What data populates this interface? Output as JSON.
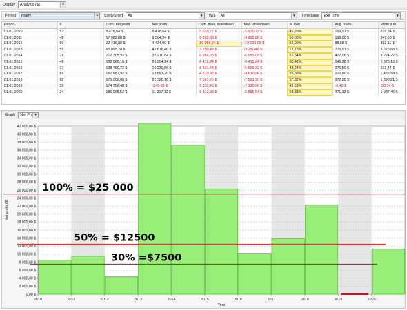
{
  "toolbar": {
    "display_label": "Display",
    "display_value": "Analysis ($)"
  },
  "filters": {
    "period_label": "Period",
    "period_value": "Yearly",
    "longshort_label": "Long/Short",
    "longshort_value": "All",
    "wl_label": "W/L",
    "wl_value": "All",
    "timebase_label": "Time base",
    "timebase_value": "Exit Time"
  },
  "table": {
    "headers": [
      "Period",
      "#",
      "Cum. net profit",
      "Net profit",
      "Cum. max. drawdown",
      "Max. drawdown",
      "% Win",
      "Avg. trade",
      "Profit p.m."
    ],
    "rows": [
      [
        "01.01.2010",
        "53",
        "8 478,64 $",
        "8 478,64 $",
        "-5 930,72 $",
        "-5 930,72 $",
        "45,28%",
        "159,97 $",
        "828,84 $"
      ],
      [
        "01.01.2011",
        "48",
        "17 982,88 $",
        "9 504,24 $",
        "-9 992,88 $",
        "-9 992,88 $",
        "50,00%",
        "198,00 $",
        "847,60 $"
      ],
      [
        "01.01.2012",
        "50",
        "22 416,88 $",
        "4 434,00 $",
        "-10 056,24 $",
        "-10 036,08 $",
        "52,00%",
        "88,68 $",
        "383,11 $"
      ],
      [
        "01.01.2013",
        "55",
        "65 095,28 $",
        "42 678,40 $",
        "-3 250,48 $",
        "-3 250,48 $",
        "72,73%",
        "775,97 $",
        "3 625,68 $"
      ],
      [
        "01.01.2014",
        "78",
        "102 305,92 $",
        "37 210,64 $",
        "-6 966,08 $",
        "-6 966,08 $",
        "61,54%",
        "477,06 $",
        "3 224,22 $"
      ],
      [
        "01.01.2015",
        "48",
        "128 560,16 $",
        "26 254,24 $",
        "-6 415,84 $",
        "-6 415,84 $",
        "60,42%",
        "546,96 $",
        "2 376,13 $"
      ],
      [
        "01.01.2016",
        "37",
        "138 790,72 $",
        "10 230,56 $",
        "-8 331,44 $",
        "-5 626,32 $",
        "43,24%",
        "276,50 $",
        "931,44 $"
      ],
      [
        "01.01.2017",
        "65",
        "152 687,92 $",
        "13 897,20 $",
        "-4 610,96 $",
        "-4 610,96 $",
        "55,38%",
        "213,80 $",
        "1 456,58 $"
      ],
      [
        "01.01.2018",
        "82",
        "175 008,08 $",
        "22 320,16 $",
        "-7 581,20 $",
        "-7 581,20 $",
        "57,32%",
        "272,20 $",
        "1 893,21 $"
      ],
      [
        "01.01.2019",
        "39",
        "174 758,40 $",
        "-249,68 $",
        "-7 332,40 $",
        "-7 130,96 $",
        "43,59%",
        "-6,40 $",
        "-30,34 $"
      ],
      [
        "01.01.2020",
        "24",
        "186 065,52 $",
        "11 307,12 $",
        "-6 312,88 $",
        "-5 585,84 $",
        "58,33%",
        "471,13 $",
        "1 937,46 $"
      ]
    ]
  },
  "graph": {
    "graph_label": "Graph",
    "metric_value": "Net Profit"
  },
  "chart_data": {
    "type": "bar",
    "categories": [
      "2010",
      "2011",
      "2012",
      "2013",
      "2014",
      "2015",
      "2016",
      "2017",
      "2018",
      "2019",
      "2020"
    ],
    "values": [
      8478.64,
      9504.24,
      4434.0,
      42678.4,
      37210.64,
      26254.24,
      10230.56,
      13897.2,
      22320.16,
      -249.68,
      11307.12
    ],
    "ylabel": "Net profit ($)",
    "xlabel": "Year",
    "ylim": [
      0,
      42000
    ],
    "ytick_step": 2000,
    "ytick_labels": [
      "0,00 $",
      "2 000,00 $",
      "4 000,00 $",
      "6 000,00 $",
      "8 000,00 $",
      "10 000,00 $",
      "12 000,00 $",
      "14 000,00 $",
      "16 000,00 $",
      "18 000,00 $",
      "20 000,00 $",
      "22 000,00 $",
      "24 000,00 $",
      "26 000,00 $",
      "28 000,00 $",
      "30 000,00 $",
      "32 000,00 $",
      "34 000,00 $",
      "36 000,00 $",
      "38 000,00 $",
      "40 000,00 $",
      "42 000,00 $"
    ],
    "xtick_labels": [
      "2010",
      "2011",
      "2012",
      "2013",
      "2014",
      "2015",
      "2016",
      "2017",
      "2018",
      "2019",
      "2020"
    ],
    "bar_color": "#99ee7a",
    "bar_edge": "#5fbf3f",
    "negative_color": "#cc1122",
    "annotations": [
      {
        "text": "100% = $25 000",
        "value": 25000
      },
      {
        "text": "50% = $12500",
        "value": 12500
      },
      {
        "text": "30% =$7500",
        "value": 7500
      }
    ]
  }
}
